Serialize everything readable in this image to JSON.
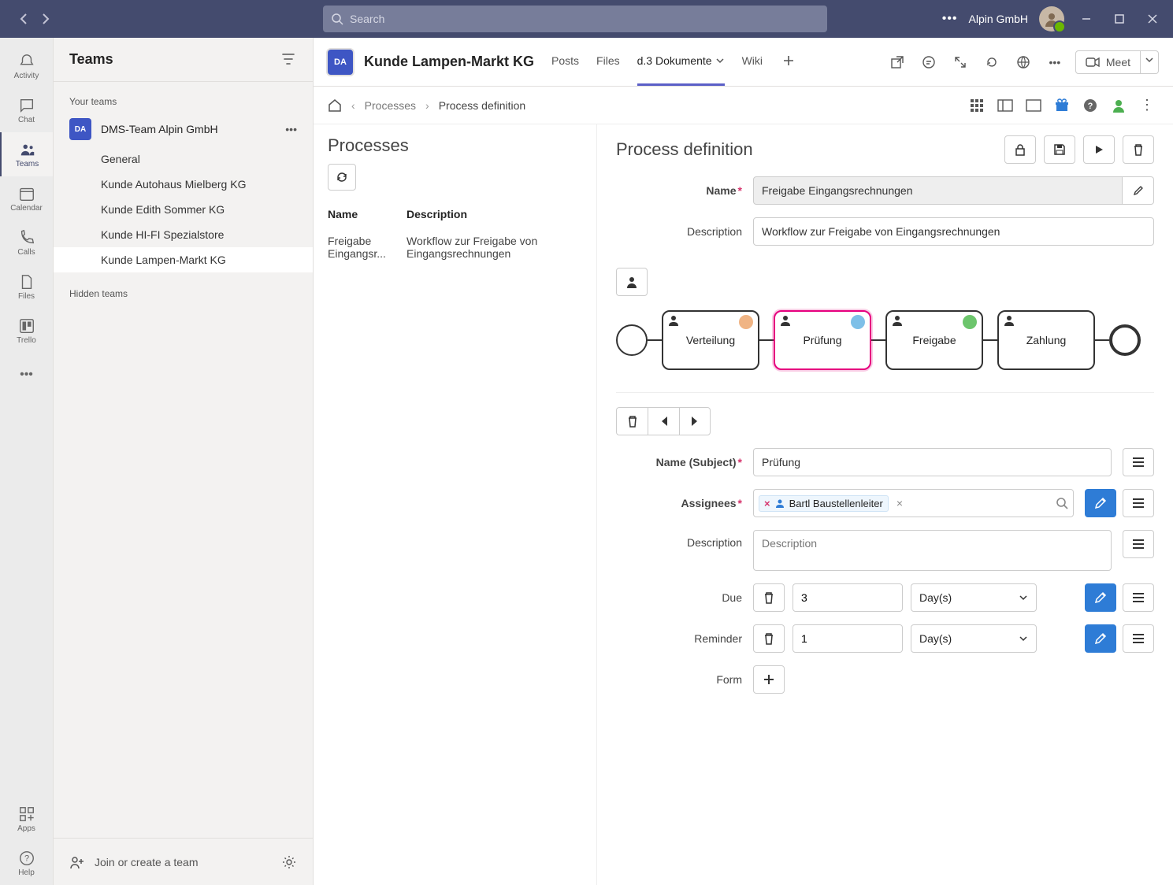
{
  "titlebar": {
    "search_placeholder": "Search",
    "tenant": "Alpin GmbH"
  },
  "rail": {
    "items": [
      {
        "label": "Activity"
      },
      {
        "label": "Chat"
      },
      {
        "label": "Teams"
      },
      {
        "label": "Calendar"
      },
      {
        "label": "Calls"
      },
      {
        "label": "Files"
      },
      {
        "label": "Trello"
      }
    ],
    "apps_label": "Apps",
    "help_label": "Help"
  },
  "teamsPanel": {
    "title": "Teams",
    "your_teams": "Your teams",
    "team_badge": "DA",
    "team_name": "DMS-Team Alpin GmbH",
    "channels": [
      "General",
      "Kunde Autohaus Mielberg KG",
      "Kunde Edith Sommer KG",
      "Kunde HI-FI Spezialstore",
      "Kunde Lampen-Markt KG"
    ],
    "hidden_teams": "Hidden teams",
    "join_label": "Join or create a team"
  },
  "channelHeader": {
    "badge": "DA",
    "title": "Kunde Lampen-Markt KG",
    "tabs": [
      "Posts",
      "Files",
      "d.3 Dokumente",
      "Wiki"
    ],
    "meet": "Meet"
  },
  "breadcrumb": {
    "processes": "Processes",
    "definition": "Process definition"
  },
  "processes": {
    "title": "Processes",
    "col_name": "Name",
    "col_desc": "Description",
    "rows": [
      {
        "name": "Freigabe Eingangsr...",
        "desc": "Workflow zur Freigabe von Eingangsrechnungen"
      }
    ]
  },
  "definition": {
    "title": "Process definition",
    "name_label": "Name",
    "desc_label": "Description",
    "name_value": "Freigabe Eingangsrechnungen",
    "desc_value": "Workflow zur Freigabe von Eingangsrechnungen",
    "flow": [
      "Verteilung",
      "Prüfung",
      "Freigabe",
      "Zahlung"
    ],
    "step": {
      "subject_label": "Name (Subject)",
      "subject_value": "Prüfung",
      "assignees_label": "Assignees",
      "assignee_name": "Bartl Baustellenleiter",
      "desc_label": "Description",
      "desc_placeholder": "Description",
      "due_label": "Due",
      "due_value": "3",
      "due_unit": "Day(s)",
      "reminder_label": "Reminder",
      "reminder_value": "1",
      "reminder_unit": "Day(s)",
      "form_label": "Form"
    }
  }
}
